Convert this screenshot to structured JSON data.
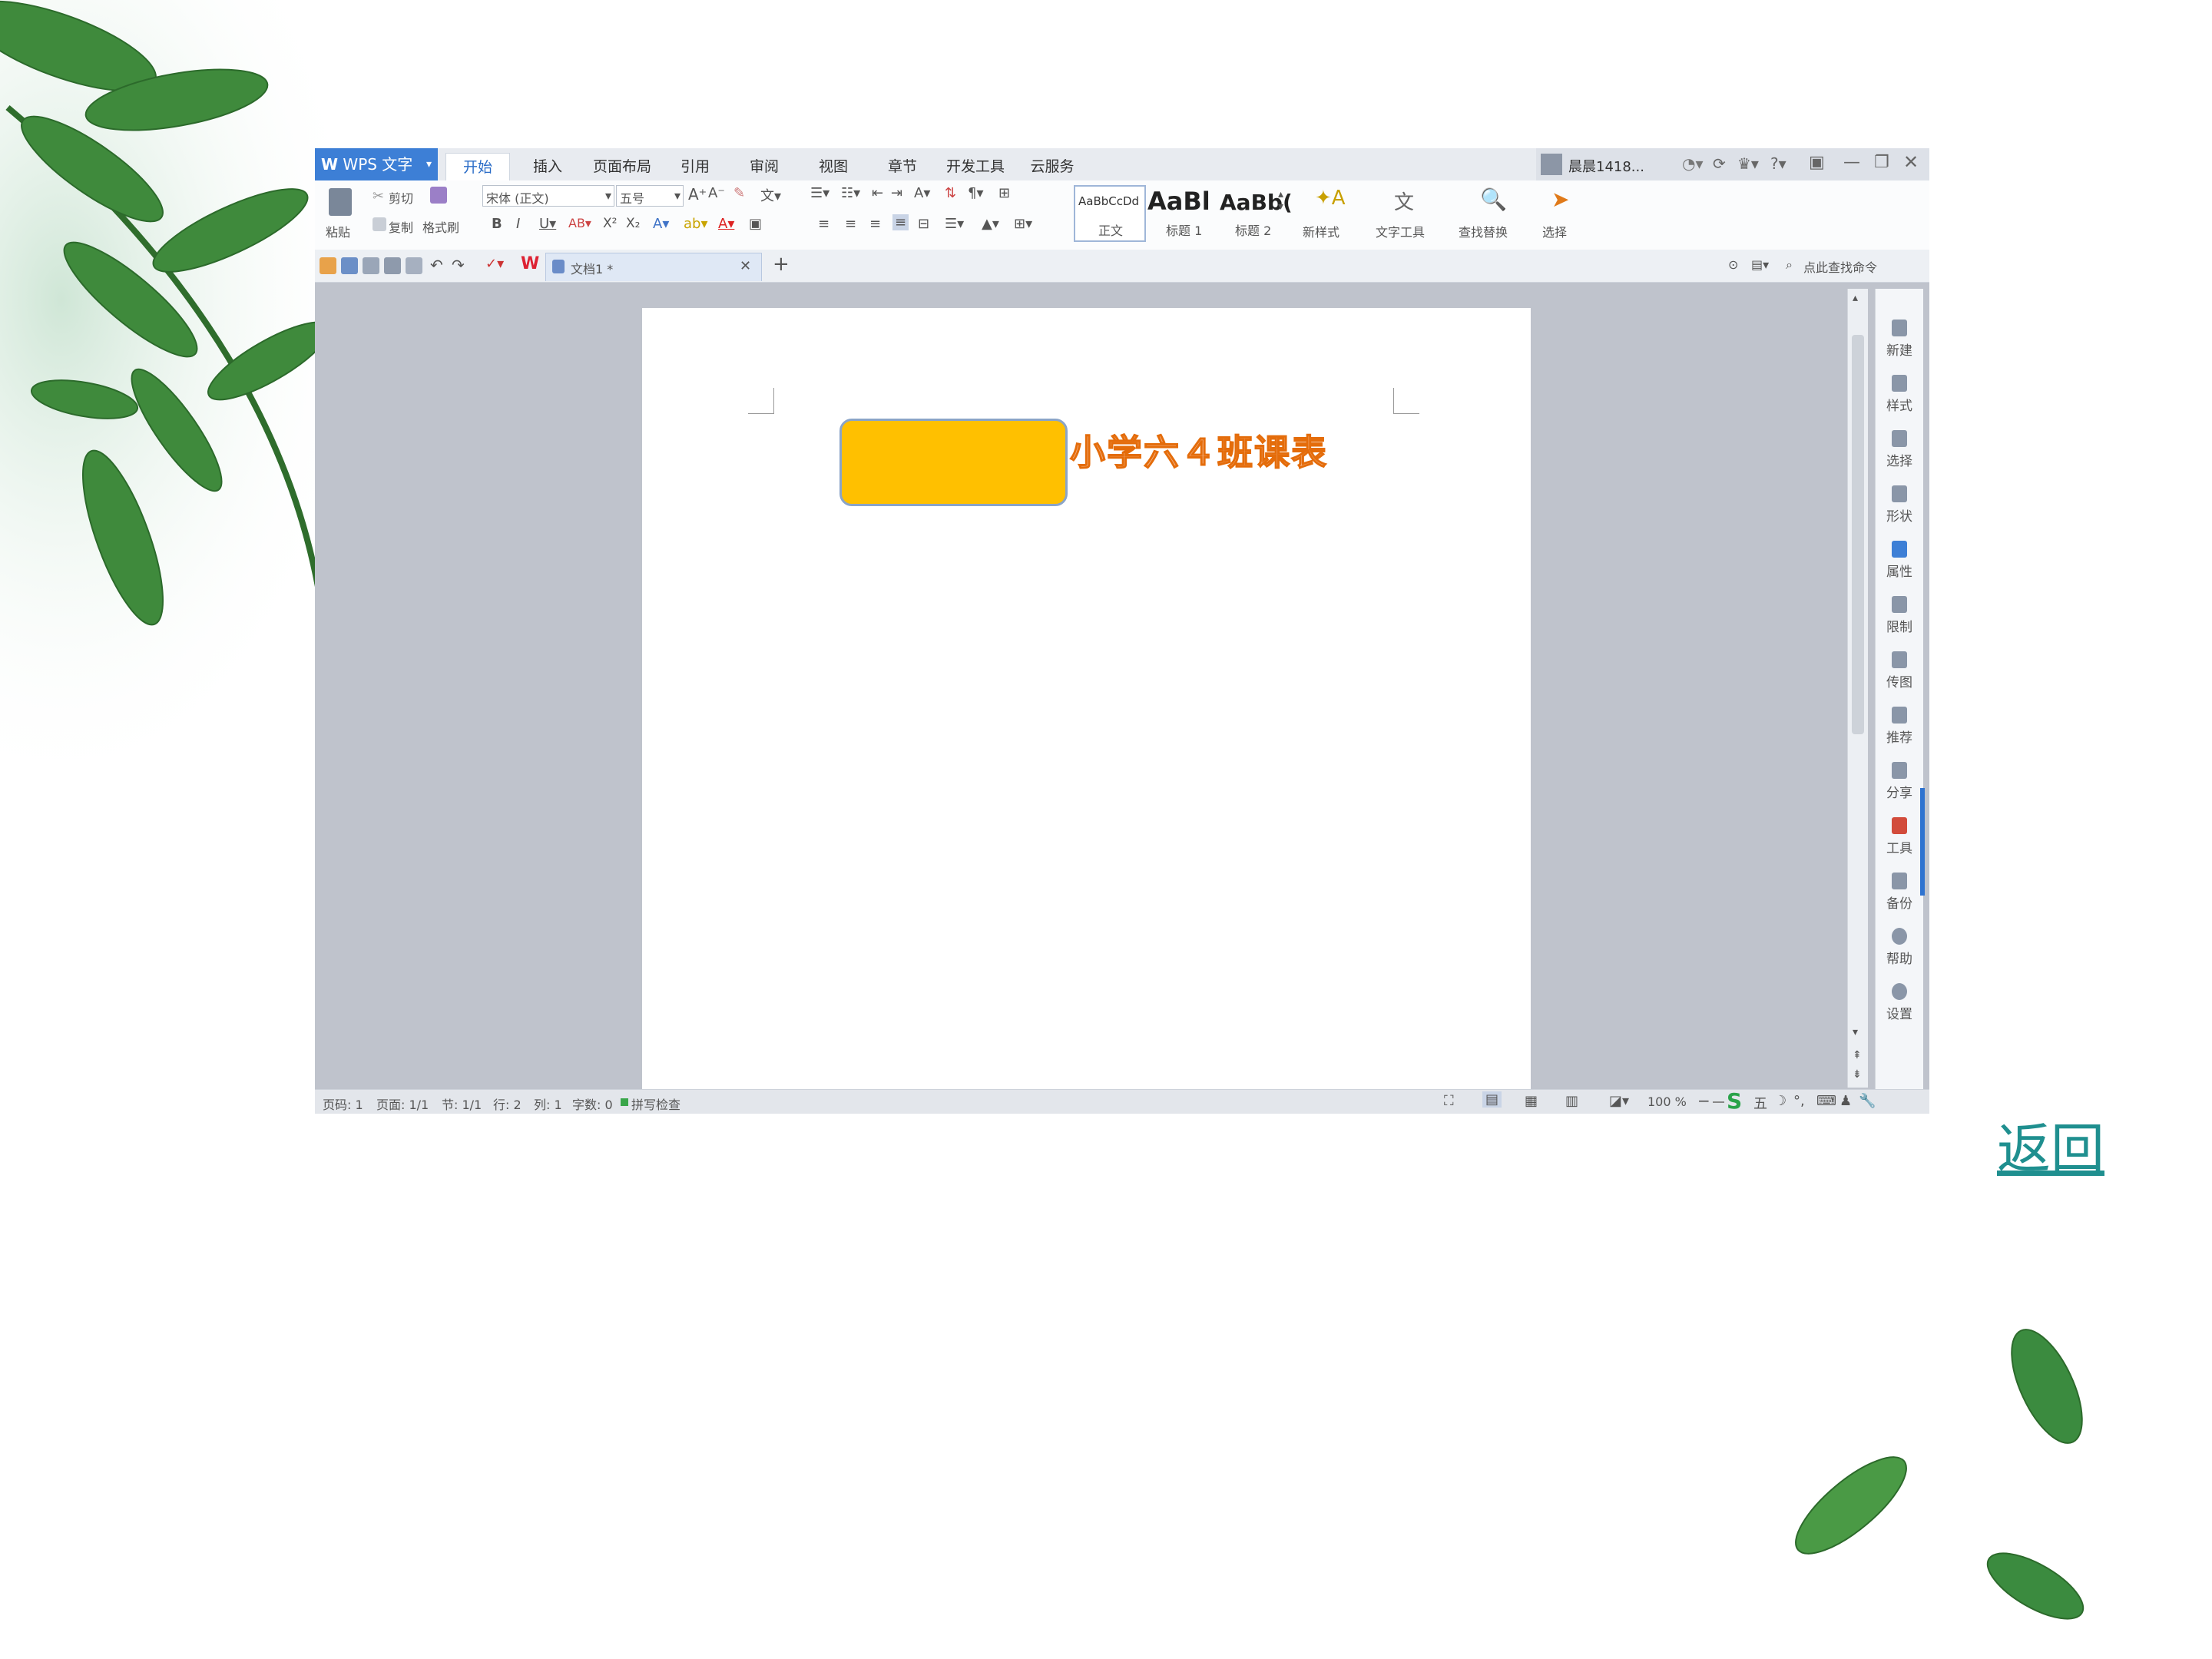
{
  "slide": {
    "back_link": "返回"
  },
  "app": {
    "logo": "WPS 文字",
    "tabs": [
      "开始",
      "插入",
      "页面布局",
      "引用",
      "审阅",
      "视图",
      "章节",
      "开发工具",
      "云服务"
    ],
    "active_tab": 0,
    "user_name": "晨晨1418..."
  },
  "ribbon": {
    "paste": "粘贴",
    "cut": "剪切",
    "copy": "复制",
    "format_painter": "格式刷",
    "font_name": "宋体 (正文)",
    "font_size": "五号",
    "styles": [
      {
        "preview": "AaBbCcDd",
        "label": "正文"
      },
      {
        "preview": "AaBl",
        "label": "标题 1"
      },
      {
        "preview": "AaBb(",
        "label": "标题 2"
      }
    ],
    "new_style": "新样式",
    "text_tools": "文字工具",
    "find_replace": "查找替换",
    "select": "选择"
  },
  "quickbar": {
    "doc_tab": "文档1 *",
    "search_command": "点此查找命令"
  },
  "document": {
    "title_text": "小学六４班课表"
  },
  "right_panel": [
    "新建",
    "样式",
    "选择",
    "形状",
    "属性",
    "限制",
    "传图",
    "推荐",
    "分享",
    "工具",
    "备份",
    "帮助",
    "设置"
  ],
  "status": {
    "page": "页码: 1",
    "pages": "页面: 1/1",
    "section": "节: 1/1",
    "row": "行: 2",
    "col": "列: 1",
    "words": "字数: 0",
    "spell": "拼写检查",
    "zoom": "100 %"
  },
  "colors": {
    "shape_fill": "#FFC000",
    "title_fill": "#F4B183",
    "title_outline": "#E46C0A",
    "link": "#1F8F8F",
    "logo_blue": "#3D7FD6"
  }
}
